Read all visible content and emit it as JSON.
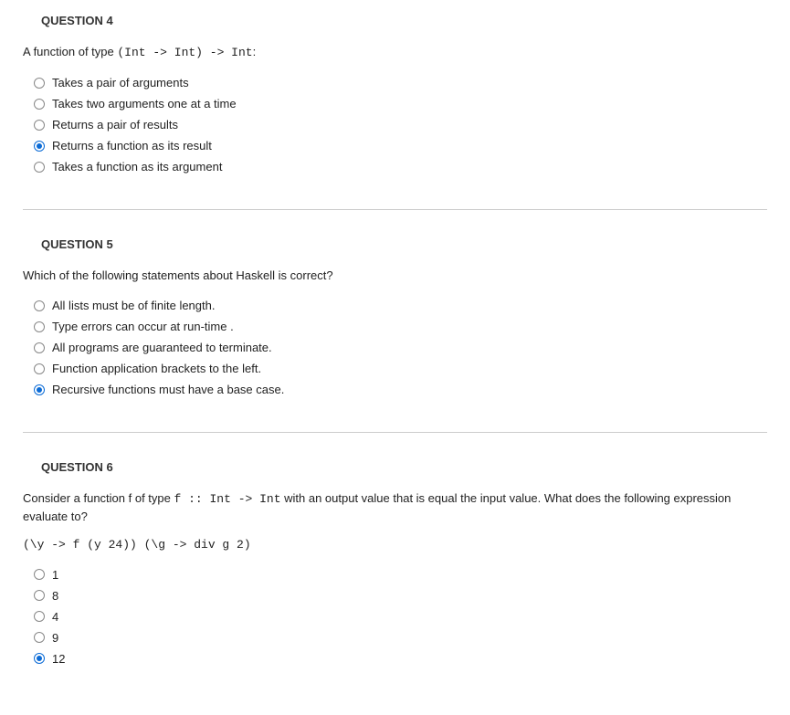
{
  "questions": [
    {
      "title": "QUESTION 4",
      "prompt_parts": [
        {
          "text": "A function of type ",
          "code": false
        },
        {
          "text": "(Int -> Int) -> Int",
          "code": true
        },
        {
          "text": ":",
          "code": false
        }
      ],
      "options": [
        {
          "label": "Takes a pair of arguments",
          "selected": false
        },
        {
          "label": "Takes two arguments one at a time",
          "selected": false
        },
        {
          "label": "Returns a pair of results",
          "selected": false
        },
        {
          "label": "Returns a function as its result",
          "selected": true
        },
        {
          "label": "Takes a function as its argument",
          "selected": false
        }
      ]
    },
    {
      "title": "QUESTION 5",
      "prompt_parts": [
        {
          "text": "Which of the following statements about Haskell is correct?",
          "code": false
        }
      ],
      "options": [
        {
          "label": "All lists must be of finite length.",
          "selected": false
        },
        {
          "label": "Type errors can occur at run-time .",
          "selected": false
        },
        {
          "label": "All programs are guaranteed to terminate.",
          "selected": false
        },
        {
          "label": "Function application brackets to the left.",
          "selected": false
        },
        {
          "label": "Recursive functions must have a base case.",
          "selected": true
        }
      ]
    },
    {
      "title": "QUESTION 6",
      "prompt_parts": [
        {
          "text": "Consider a function f of type ",
          "code": false
        },
        {
          "text": "f :: Int -> Int",
          "code": true
        },
        {
          "text": " with an output value that is equal the input value. What does the following expression evaluate to?",
          "code": false
        }
      ],
      "prompt_line2": [
        {
          "text": "(\\y -> f (y 24)) (\\g -> div g 2)",
          "code": true
        }
      ],
      "options": [
        {
          "label": "1",
          "selected": false
        },
        {
          "label": "8",
          "selected": false
        },
        {
          "label": "4",
          "selected": false
        },
        {
          "label": "9",
          "selected": false
        },
        {
          "label": "12",
          "selected": true
        }
      ]
    }
  ]
}
